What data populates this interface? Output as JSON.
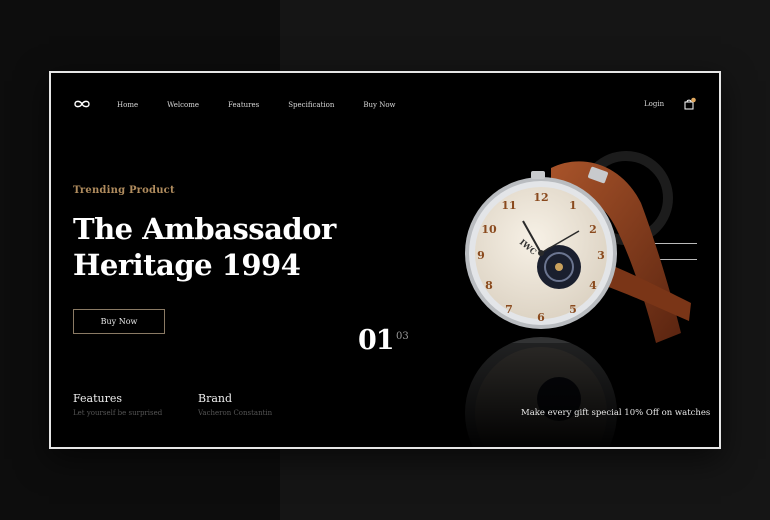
{
  "nav": {
    "logo_icon": "infinity-icon",
    "items": [
      "Home",
      "Welcome",
      "Features",
      "Specification",
      "Buy Now"
    ],
    "login": "Login",
    "cart_icon": "shopping-bag-icon",
    "cart_badge_color": "#e0a860"
  },
  "hero": {
    "eyebrow": "Trending Product",
    "title_line1": "The Ambassador",
    "title_line2": "Heritage 1994",
    "button": "Buy Now"
  },
  "info": {
    "features": {
      "title": "Features",
      "sub": "Let yourself be surprised"
    },
    "brand": {
      "title": "Brand",
      "sub": "Vacheron Constantin"
    }
  },
  "slider": {
    "current": "01",
    "total": "03"
  },
  "promo": "Make every gift special 10% Off on watches",
  "watch": {
    "brand_mark": "IWC",
    "dial_numbers": [
      "12",
      "1",
      "2",
      "3",
      "4",
      "5",
      "6",
      "7",
      "8",
      "9",
      "10",
      "11"
    ]
  },
  "colors": {
    "accent": "#b08c5e",
    "background": "#000000",
    "strap": "#8a3f1c"
  }
}
